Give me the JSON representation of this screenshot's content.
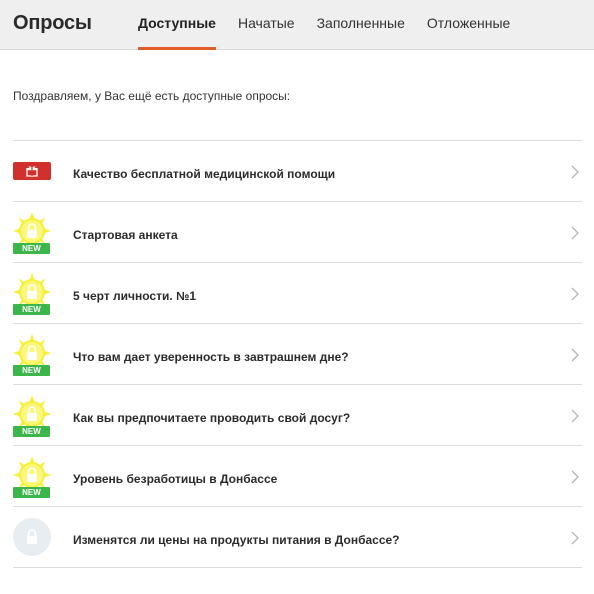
{
  "header": {
    "title": "Опросы",
    "tabs": [
      {
        "label": "Доступные",
        "active": true
      },
      {
        "label": "Начатые",
        "active": false
      },
      {
        "label": "Заполненные",
        "active": false
      },
      {
        "label": "Отложенные",
        "active": false
      }
    ]
  },
  "intro": "Поздравляем, у Вас ещё есть доступные опросы:",
  "colors": {
    "accent": "#e35d2b",
    "gift": "#d0312d",
    "new_badge": "#3cb54a",
    "sun": "#f6f03a"
  },
  "surveys": [
    {
      "label": "Качество бесплатной медицинской помощи",
      "icon": "gift-icon"
    },
    {
      "label": "Стартовая анкета",
      "icon": "sun-lock-icon",
      "badge": "NEW"
    },
    {
      "label": "5 черт личности. №1",
      "icon": "sun-lock-icon",
      "badge": "NEW"
    },
    {
      "label": "Что вам дает уверенность в завтрашнем дне?",
      "icon": "sun-lock-icon",
      "badge": "NEW"
    },
    {
      "label": "Как вы предпочитаете проводить свой досуг?",
      "icon": "sun-lock-icon",
      "badge": "NEW"
    },
    {
      "label": "Уровень безработицы в Донбассе",
      "icon": "sun-lock-icon",
      "badge": "NEW"
    },
    {
      "label": "Изменятся ли цены на продукты питания в Донбассе?",
      "icon": "lock-icon"
    }
  ]
}
